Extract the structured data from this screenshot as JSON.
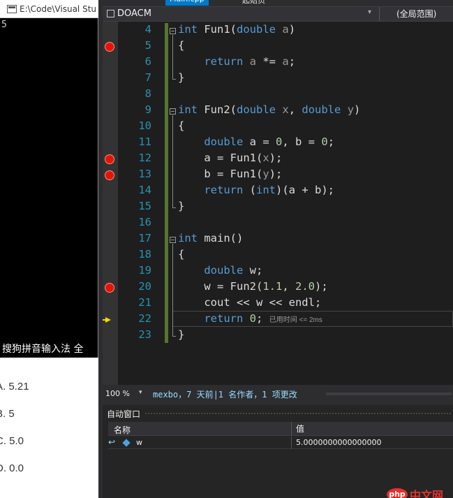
{
  "console": {
    "title": "E:\\Code\\Visual Stu",
    "output": "5",
    "ime_text": "搜狗拼音输入法 全"
  },
  "quiz": {
    "options": [
      "A. 5.21",
      "B. 5",
      "C. 5.0",
      "D. 0.0"
    ]
  },
  "editor": {
    "tabs": {
      "active": "Main.cpp",
      "inactive": "起始页"
    },
    "project": "DOACM",
    "scope": "(全局范围)",
    "breakpoint_lines": [
      5,
      12,
      13,
      20
    ],
    "current_line": 22,
    "lines": [
      {
        "no": "4",
        "code": "int Fun1(double a)"
      },
      {
        "no": "5",
        "code": "{"
      },
      {
        "no": "6",
        "code": "    return a *= a;"
      },
      {
        "no": "7",
        "code": "}"
      },
      {
        "no": "8",
        "code": ""
      },
      {
        "no": "9",
        "code": "int Fun2(double x, double y)"
      },
      {
        "no": "10",
        "code": "{"
      },
      {
        "no": "11",
        "code": "    double a = 0, b = 0;"
      },
      {
        "no": "12",
        "code": "    a = Fun1(x);"
      },
      {
        "no": "13",
        "code": "    b = Fun1(y);"
      },
      {
        "no": "14",
        "code": "    return (int)(a + b);"
      },
      {
        "no": "15",
        "code": "}"
      },
      {
        "no": "16",
        "code": ""
      },
      {
        "no": "17",
        "code": "int main()"
      },
      {
        "no": "18",
        "code": "{"
      },
      {
        "no": "19",
        "code": "    double w;"
      },
      {
        "no": "20",
        "code": "    w = Fun2(1.1, 2.0);"
      },
      {
        "no": "21",
        "code": "    cout << w << endl;"
      },
      {
        "no": "22",
        "code": "    return 0;"
      },
      {
        "no": "23",
        "code": "}"
      }
    ],
    "elapsed_hint": "已用时间 <= 2ms"
  },
  "status": {
    "zoom": "100 %",
    "codelens": "mexbo，7 天前|1 名作者，1 项更改"
  },
  "autos": {
    "title": "自动窗口",
    "col_name": "名称",
    "col_value": "值",
    "rows": [
      {
        "name": "w",
        "value": "5.0000000000000000"
      }
    ]
  },
  "watermark": {
    "logo": "php",
    "text": "中文网"
  },
  "colors": {
    "keyword": "#569cd6",
    "param": "#9a9a9a",
    "number": "#b5cea8",
    "breakpoint": "#e51400",
    "accent": "#007acc"
  }
}
